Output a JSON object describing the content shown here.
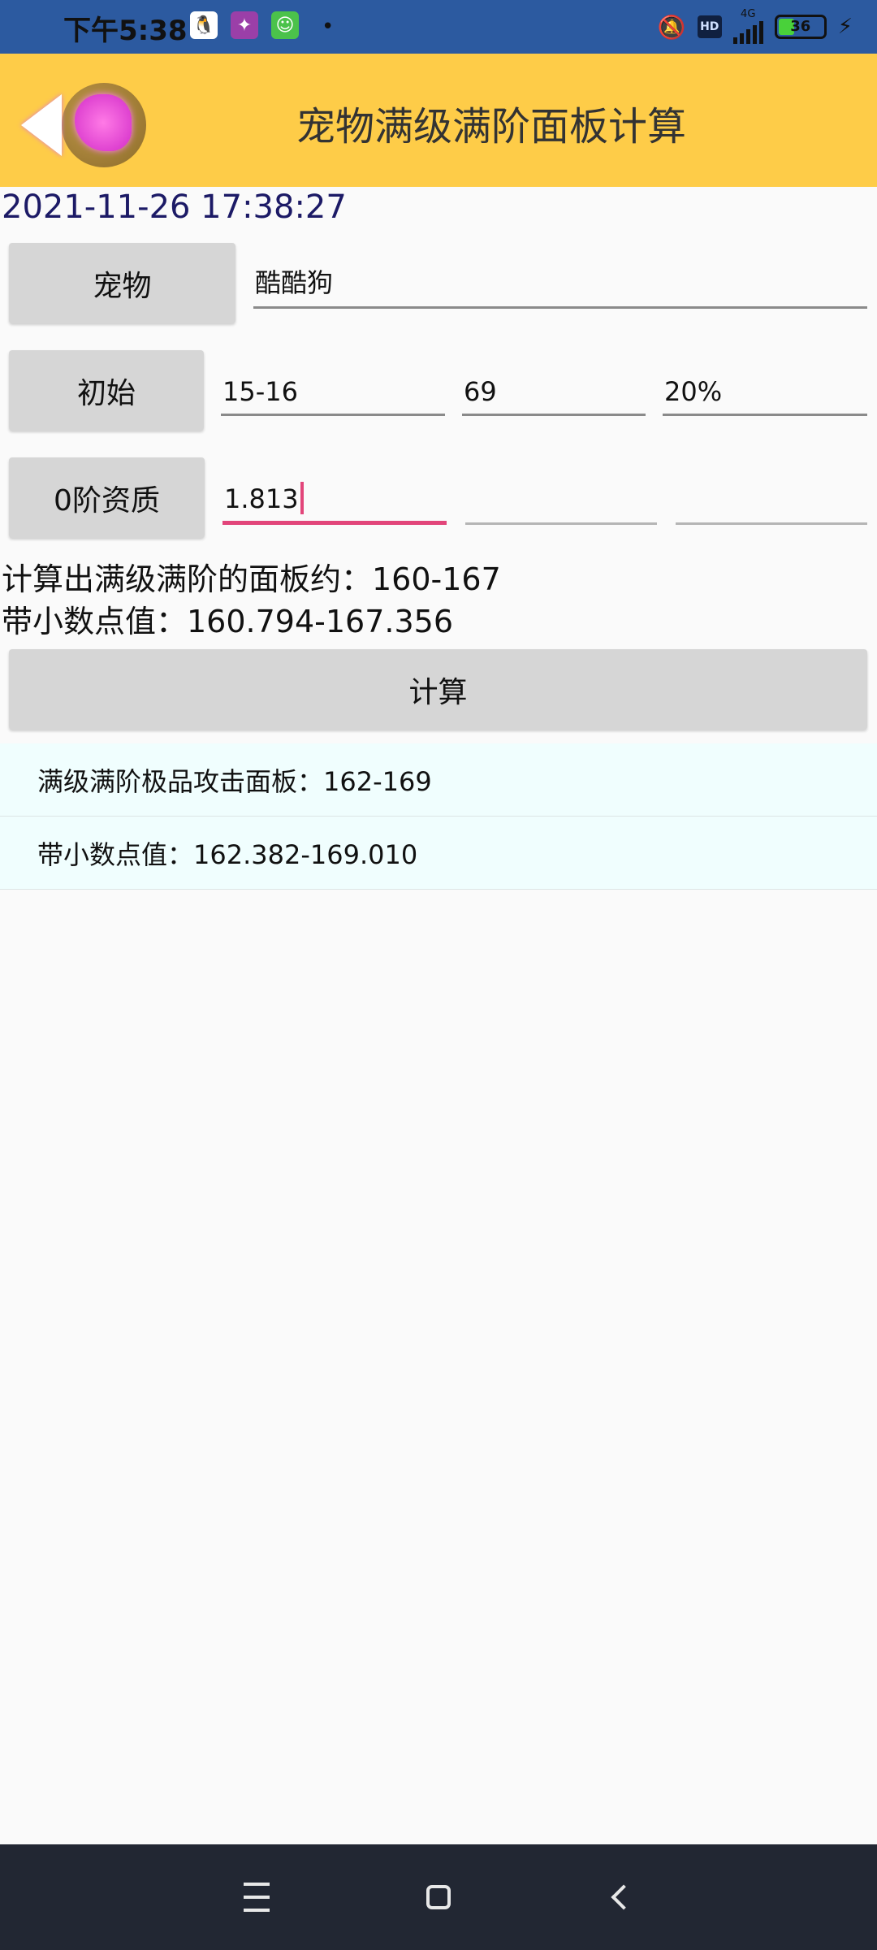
{
  "status_bar": {
    "time": "下午5:38",
    "network": "4G",
    "hd": "HD",
    "battery": "36",
    "battery_level_percent": 36
  },
  "toolbar": {
    "title": "宠物满级满阶面板计算"
  },
  "datetime": "2021-11-26 17:38:27",
  "pet": {
    "button_label": "宠物",
    "value": "酷酷狗"
  },
  "initial": {
    "button_label": "初始",
    "values": [
      "15-16",
      "69",
      "20%"
    ]
  },
  "aptitude": {
    "button_label": "0阶资质",
    "values": [
      "1.813",
      "",
      ""
    ]
  },
  "result": {
    "line1": "计算出满级满阶的面板约：160-167",
    "line2": "带小数点值：160.794-167.356"
  },
  "calculate_label": "计算",
  "list": [
    "满级满阶极品攻击面板：162-169",
    "带小数点值：162.382-169.010"
  ],
  "colors": {
    "toolbar": "#fecc48",
    "status_bar": "#2c5aa0",
    "accent": "#e2457a",
    "list_bg": "#f0fefe",
    "nav_bar": "#222733"
  }
}
